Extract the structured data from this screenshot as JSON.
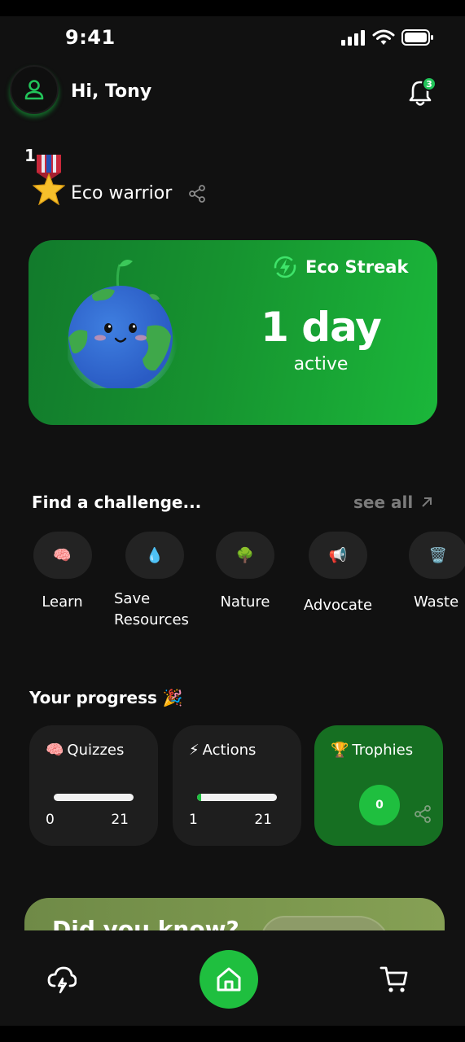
{
  "status_bar": {
    "time": "9:41"
  },
  "header": {
    "greeting": "Hi, Tony",
    "notification_count": "3"
  },
  "rank": {
    "number": "1",
    "title": "Eco warrior"
  },
  "streak": {
    "label": "Eco Streak",
    "value": "1 day",
    "sub": "active"
  },
  "challenges": {
    "title": "Find a challenge...",
    "see_all": "see all",
    "categories": [
      {
        "emoji": "🧠",
        "label": "Learn"
      },
      {
        "emoji": "💧",
        "label": "Save Resources"
      },
      {
        "emoji": "🌳",
        "label": "Nature"
      },
      {
        "emoji": "📢",
        "label": "Advocate"
      },
      {
        "emoji": "🗑️",
        "label": "Waste"
      }
    ]
  },
  "progress": {
    "title": "Your progress 🎉",
    "quizzes": {
      "emoji": "🧠",
      "label": "Quizzes",
      "min": "0",
      "max": "21",
      "fraction": 0
    },
    "actions": {
      "emoji": "⚡",
      "label": "Actions",
      "min": "1",
      "max": "21",
      "fraction": 0.05
    },
    "trophies": {
      "emoji": "🏆",
      "label": "Trophies",
      "count": "0"
    }
  },
  "did_you_know": {
    "title": "Did you know?"
  },
  "colors": {
    "accent": "#1fbf3f",
    "background": "#111111",
    "card": "#1e1e1e"
  }
}
